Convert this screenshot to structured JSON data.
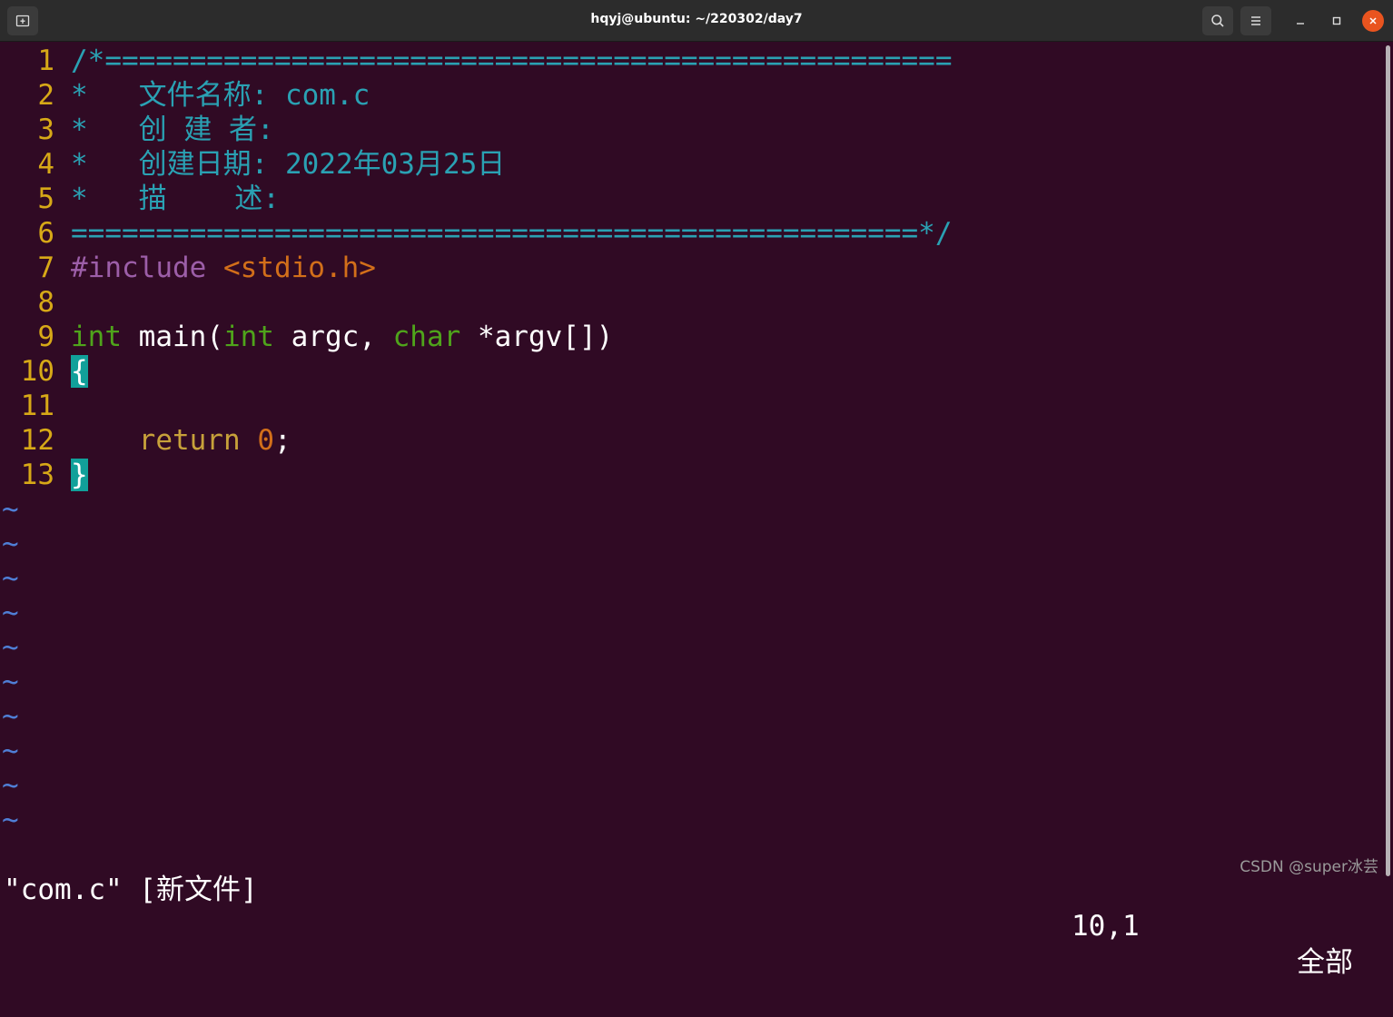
{
  "window": {
    "title": "hqyj@ubuntu: ~/220302/day7",
    "buttons": [
      "new-tab-icon",
      "search-icon",
      "menu-icon",
      "minimize-icon",
      "maximize-icon",
      "close-icon"
    ]
  },
  "editor": {
    "lines": [
      {
        "num": "1",
        "segments": [
          {
            "t": "/*==================================================",
            "c": "c-comment"
          }
        ]
      },
      {
        "num": "2",
        "segments": [
          {
            "t": "*   文件名称: com.c",
            "c": "c-comment"
          }
        ]
      },
      {
        "num": "3",
        "segments": [
          {
            "t": "*   创 建 者:",
            "c": "c-comment"
          }
        ]
      },
      {
        "num": "4",
        "segments": [
          {
            "t": "*   创建日期: 2022年03月25日",
            "c": "c-comment"
          }
        ]
      },
      {
        "num": "5",
        "segments": [
          {
            "t": "*   描    述:",
            "c": "c-comment"
          }
        ]
      },
      {
        "num": "6",
        "segments": [
          {
            "t": "==================================================*/",
            "c": "c-comment"
          }
        ]
      },
      {
        "num": "7",
        "segments": [
          {
            "t": "#include ",
            "c": "c-pre"
          },
          {
            "t": "<stdio.h>",
            "c": "c-inc"
          }
        ]
      },
      {
        "num": "8",
        "segments": []
      },
      {
        "num": "9",
        "segments": [
          {
            "t": "int",
            "c": "c-type"
          },
          {
            "t": " main(",
            "c": "c-plain"
          },
          {
            "t": "int",
            "c": "c-type"
          },
          {
            "t": " argc, ",
            "c": "c-plain"
          },
          {
            "t": "char",
            "c": "c-type"
          },
          {
            "t": " *argv[])",
            "c": "c-plain"
          }
        ]
      },
      {
        "num": "10",
        "segments": [
          {
            "t": "{",
            "c": "cursor"
          }
        ]
      },
      {
        "num": "11",
        "segments": []
      },
      {
        "num": "12",
        "segments": [
          {
            "t": "    ",
            "c": "c-plain"
          },
          {
            "t": "return",
            "c": "c-ret"
          },
          {
            "t": " ",
            "c": "c-plain"
          },
          {
            "t": "0",
            "c": "c-num"
          },
          {
            "t": ";",
            "c": "c-plain"
          }
        ]
      },
      {
        "num": "13",
        "segments": [
          {
            "t": "}",
            "c": "cursor"
          }
        ]
      }
    ],
    "tilde_rows": [
      "~",
      "~",
      "~",
      "~",
      "~",
      "~",
      "~",
      "~",
      "~",
      "~"
    ]
  },
  "status": {
    "file_message": "\"com.c\" [新文件]",
    "cursor_position": "10,1",
    "scroll_position": "全部"
  },
  "watermark": "CSDN @super冰芸",
  "colors": {
    "background": "#300a24",
    "line_number": "#d7a917",
    "comment": "#2aa1b3",
    "type_keyword": "#4fa41b",
    "cursor_bg": "#11a09a",
    "tilde": "#4f7fd6"
  }
}
